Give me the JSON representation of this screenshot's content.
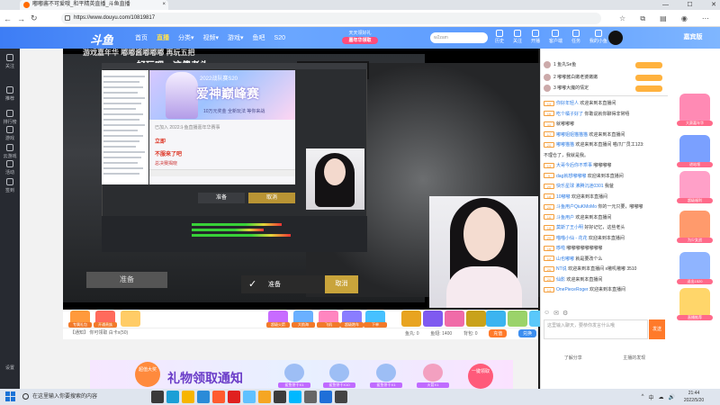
{
  "browser": {
    "tab_title": "嘟嘟酱不可爱哦_和平精英直播_斗鱼直播",
    "url": "https://www.douyu.com/10819817",
    "nav": [
      "←",
      "→",
      "↻"
    ],
    "window_controls": [
      "—",
      "☐",
      "✕"
    ]
  },
  "site": {
    "logo": "斗鱼",
    "nav": [
      "首页",
      "直播",
      "分类▾",
      "视频▾",
      "游戏▾",
      "鱼吧",
      "S20"
    ],
    "promo_top": "天天领好礼",
    "promo_bottom": "嘉年华领取",
    "search_placeholder": "w2zam",
    "user_items": [
      "历史",
      "关注",
      "开播",
      "客户端",
      "任务",
      "我的小鱼"
    ],
    "corner_text": "嘉宾版"
  },
  "leftnav": [
    {
      "label": "关注"
    },
    {
      "label": "推荐"
    },
    {
      "label": "排行榜"
    },
    {
      "label": "游戏"
    },
    {
      "label": "云游戏"
    },
    {
      "label": "活动"
    },
    {
      "label": "签到"
    }
  ],
  "leftnav_bottom": "设置",
  "stream": {
    "top_caption": "游戏嘉年华    嘟嘟酱嘟嘟嘟    再玩五把",
    "subtitle": "好玩吧，这傻老头",
    "banner_top": "2022战队赛S20",
    "banner_title": "爱神巅峰赛",
    "banner_sub": "10万元奖金 全新玩法 等你来战",
    "dlg_line1": "已加入 2022斗鱼直播嘉年华赛事",
    "dlg_red1": "立即",
    "dlg_red2": "不服来了吧",
    "dlg_red3": "总决赛揭晓",
    "obs_prepare": "准备",
    "obs_cancel": "取消",
    "big_prepare": "准备",
    "confirm_prepare": "准备",
    "confirm_cancel": "取消"
  },
  "gifts": [
    {
      "label": "专属礼包",
      "color": "#ff9a3c"
    },
    {
      "label": "开通贵族",
      "color": "#ff6a5c"
    },
    {
      "label": "",
      "color": "#ffcc66"
    },
    {
      "label": "超级火箭",
      "color": "#c86bff"
    },
    {
      "label": "大航海",
      "color": "#6ab0ff"
    },
    {
      "label": "飞机",
      "color": "#ff86c0"
    },
    {
      "label": "超级跑车",
      "color": "#8a7dff"
    },
    {
      "label": "下单",
      "color": "#46c1ff"
    },
    {
      "label": "",
      "color": "#e8a420"
    },
    {
      "label": "",
      "color": "#7f5af0"
    },
    {
      "label": "",
      "color": "#f06ba8"
    },
    {
      "label": "",
      "color": "#c9a21a"
    },
    {
      "label": "",
      "color": "#3bb4f0"
    },
    {
      "label": "",
      "color": "#9bd36a"
    },
    {
      "label": "",
      "color": "#5ac8fa"
    }
  ],
  "infobar": {
    "notice": "【通知】 你可领取 白卡x(50)",
    "fish_balls": "鱼丸: 0",
    "fish_bar": "鱼翅: 1400",
    "items": "背包: 0",
    "btn_charge": "充值",
    "btn_fill": "兑换",
    "btn_charge_color": "#ff7a2a",
    "btn_fill_color": "#3c8ef0"
  },
  "ad": {
    "badge": "超值大奖",
    "title": "礼物领取通知",
    "gifts": [
      "鲨鱼饼干X1",
      "鲨鱼饼干X10",
      "鲨鱼饼干X1",
      "火箭X1"
    ],
    "collect": "一键领取"
  },
  "chat": {
    "top_ranks": [
      {
        "name": "鱼丸Se鱼",
        "rank": "1"
      },
      {
        "name": "嘟嘟酱白嫩老婆嫩嫩",
        "rank": "2"
      },
      {
        "name": "嘟嘟大魔的情定",
        "rank": "3"
      }
    ],
    "messages": [
      {
        "lv": "14",
        "name": "你好年轻人",
        "text": "欢迎来到本直播间"
      },
      {
        "lv": "16",
        "name": "吃个橘子好了",
        "text": "你敢说就你聊得非常嘻"
      },
      {
        "lv": "11",
        "name": "",
        "text": "就嘟嘟嘟"
      },
      {
        "lv": "17",
        "name": "嘟嘟姐姐猫猫猫",
        "text": "欢迎来到本直播间"
      },
      {
        "lv": "20",
        "name": "嘟嘟猫猫",
        "text": "欢迎来到本直播间  喵爪厂员工123:"
      },
      {
        "lv": "",
        "name": "",
        "text": "不理仓了，我就是我。"
      },
      {
        "lv": "13",
        "name": "大哥今后你不乖事",
        "text": "嘟嘟嘟嘟"
      },
      {
        "lv": "9",
        "name": "dag就想嘟嘟嘟",
        "text": "欢迎来到本直播间"
      },
      {
        "lv": "20",
        "name": "快乐星球 沸腾沉迷0301",
        "text": "我爸"
      },
      {
        "lv": "18",
        "name": "10嘟嘟",
        "text": "欢迎来到本直播间"
      },
      {
        "lv": "20",
        "name": "斗鱼用户QiuKMoMo",
        "text": "你的一元只要，嘟嘟嘟"
      },
      {
        "lv": "16",
        "name": "斗鱼用户",
        "text": "欢迎来到本直播间"
      },
      {
        "lv": "18",
        "name": "莫斯了王小明",
        "text": "好好记忆，这些老头"
      },
      {
        "lv": "20",
        "name": "喵喵小仙 - 花花",
        "text": "欢迎来到本直播间"
      },
      {
        "lv": "16",
        "name": "哆啦",
        "text": "嘟嘟嘟嘟嘟嘟嘟嘟"
      },
      {
        "lv": "12",
        "name": "山也嘟嘟",
        "text": "就是要改个么"
      },
      {
        "lv": "20",
        "name": "NT说",
        "text": "欢迎来到本直播间 x嗷叽嗷嘟 3510"
      },
      {
        "lv": "20",
        "name": "仙影",
        "text": "欢迎来到本直播间"
      },
      {
        "lv": "14",
        "name": "OnePieceRoger",
        "text": "欢迎来到本直播间"
      }
    ],
    "input_placeholder": "这里输入聊天，要恭你发言什么哦",
    "send": "发送",
    "bottom_tabs": [
      "了解分享",
      "主播的发现"
    ]
  },
  "sidewidgets": [
    {
      "label": "大赛嘉年华",
      "color": "#ff8ab4"
    },
    {
      "label": "进站领",
      "color": "#7aa0ff"
    },
    {
      "label": "超级福利",
      "color": "#ffa0c8"
    },
    {
      "label": "为少女战",
      "color": "#ff9a6c"
    },
    {
      "label": "送出1520",
      "color": "#8fb4ff"
    },
    {
      "label": "直播推荐",
      "color": "#ffd66a"
    }
  ],
  "taskbar": {
    "search_placeholder": "在这里输入你要搜索的内容",
    "apps": [
      "#3a3a3a",
      "#1b9fd6",
      "#f7b500",
      "#2b8bd8",
      "#ff5b2e",
      "#e02020",
      "#5fc1ff",
      "#f5a623",
      "#3c3c3c",
      "#00b8ff",
      "#666666",
      "#1f6fd8",
      "#444444"
    ],
    "tray": [
      "^",
      "中",
      "☁",
      "🔊"
    ],
    "time": "21:44",
    "date": "2022/5/20"
  }
}
